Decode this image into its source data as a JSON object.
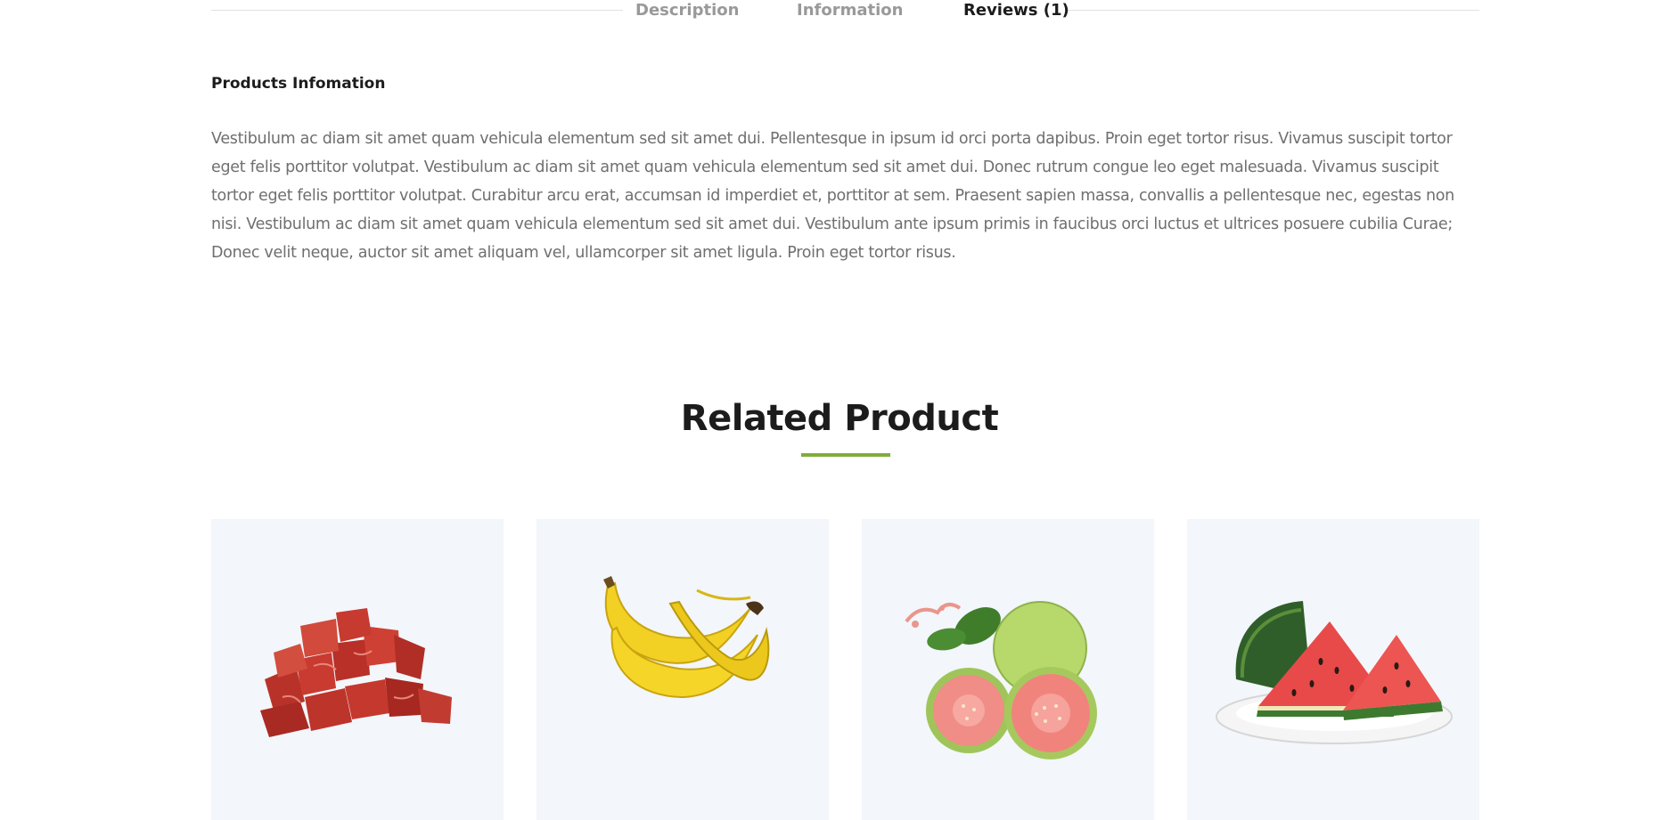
{
  "tabs": {
    "description": "Description",
    "information": "Information",
    "reviews": "Reviews (1)",
    "active": "reviews"
  },
  "info": {
    "heading": "Products Infomation",
    "text": "Vestibulum ac diam sit amet quam vehicula elementum sed sit amet dui. Pellentesque in ipsum id orci porta dapibus. Proin eget tortor risus. Vivamus suscipit tortor eget felis porttitor volutpat. Vestibulum ac diam sit amet quam vehicula elementum sed sit amet dui. Donec rutrum congue leo eget malesuada. Vivamus suscipit tortor eget felis porttitor volutpat. Curabitur arcu erat, accumsan id imperdiet et, porttitor at sem. Praesent sapien massa, convallis a pellentesque nec, egestas non nisi. Vestibulum ac diam sit amet quam vehicula elementum sed sit amet dui. Vestibulum ante ipsum primis in faucibus orci luctus et ultrices posuere cubilia Curae; Donec velit neque, auctor sit amet aliquam vel, ullamcorper sit amet ligula. Proin eget tortor risus."
  },
  "related": {
    "title": "Related Product",
    "accent_color": "#7fad39",
    "card_background": "#f3f6fa",
    "products": [
      {
        "image": "meat-cubes-image"
      },
      {
        "image": "banana-bunch-image"
      },
      {
        "image": "guava-image"
      },
      {
        "image": "watermelon-slices-image"
      }
    ]
  }
}
